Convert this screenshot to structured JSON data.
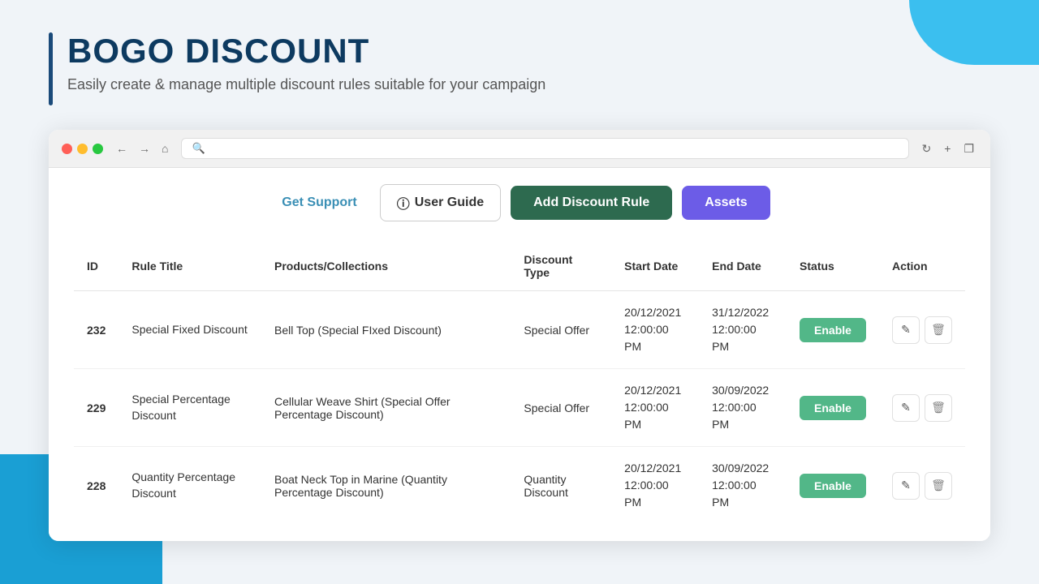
{
  "page": {
    "title": "BOGO DISCOUNT",
    "subtitle": "Easily create & manage multiple discount rules suitable for your campaign"
  },
  "toolbar": {
    "support_label": "Get Support",
    "guide_label": "User Guide",
    "guide_icon": "?",
    "add_discount_label": "Add Discount Rule",
    "assets_label": "Assets"
  },
  "table": {
    "columns": [
      "ID",
      "Rule Title",
      "Products/Collections",
      "Discount Type",
      "Start Date",
      "End Date",
      "Status",
      "Action"
    ],
    "rows": [
      {
        "id": "232",
        "rule_title": "Special Fixed Discount",
        "products": "Bell Top (Special FIxed Discount)",
        "discount_type": "Special Offer",
        "start_date": "20/12/2021",
        "start_time": "12:00:00 PM",
        "end_date": "31/12/2022",
        "end_time": "12:00:00 PM",
        "status": "Enable"
      },
      {
        "id": "229",
        "rule_title": "Special Percentage Discount",
        "products": "Cellular Weave Shirt (Special Offer Percentage Discount)",
        "discount_type": "Special Offer",
        "start_date": "20/12/2021",
        "start_time": "12:00:00 PM",
        "end_date": "30/09/2022",
        "end_time": "12:00:00 PM",
        "status": "Enable"
      },
      {
        "id": "228",
        "rule_title": "Quantity Percentage Discount",
        "products": "Boat Neck Top in Marine (Quantity Percentage Discount)",
        "discount_type": "Quantity Discount",
        "start_date": "20/12/2021",
        "start_time": "12:00:00 PM",
        "end_date": "30/09/2022",
        "end_time": "12:00:00 PM",
        "status": "Enable"
      }
    ]
  },
  "browser": {
    "address": ""
  },
  "colors": {
    "accent_teal": "#3bbfef",
    "accent_dark": "#1a4a7a",
    "green_btn": "#2d6a4f",
    "purple_btn": "#6c5ce7",
    "enable_green": "#52b788",
    "id_orange": "#e07b3a"
  }
}
